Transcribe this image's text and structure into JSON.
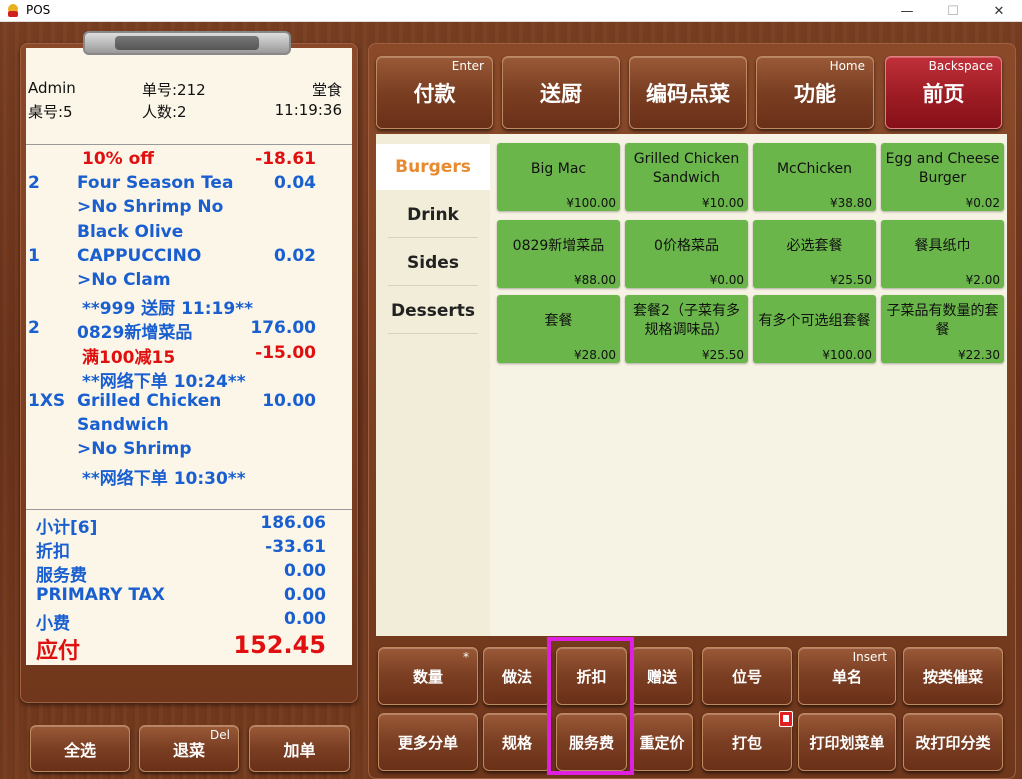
{
  "window": {
    "title": "POS",
    "minimize": "—",
    "maximize": "☐",
    "close": "✕"
  },
  "order": {
    "operator": "Admin",
    "order_no": "单号:212",
    "dine_type": "堂食",
    "table": "桌号:5",
    "guests": "人数:2",
    "time": "11:19:36"
  },
  "lines": [
    {
      "name": "10% off",
      "price": "-18.61",
      "kind": "discount"
    },
    {
      "qty": "2",
      "name": "Four Season Tea",
      "price": "0.04"
    },
    {
      "name": ">No Shrimp No",
      "kind": "mod"
    },
    {
      "name": "Black Olive",
      "kind": "mod"
    },
    {
      "qty": "1",
      "name": "CAPPUCCINO",
      "price": "0.02"
    },
    {
      "name": ">No Clam",
      "kind": "mod"
    },
    {
      "name": "**999 送厨 11:19**",
      "kind": "note"
    },
    {
      "qty": "2",
      "name": "0829新增菜品",
      "price": "176.00"
    },
    {
      "name": "满100减15",
      "price": "-15.00",
      "kind": "discount"
    },
    {
      "name": "**网络下单 10:24**",
      "kind": "note"
    },
    {
      "qty": "1XS",
      "name": "Grilled Chicken",
      "price": "10.00"
    },
    {
      "name": "Sandwich",
      "kind": "mod"
    },
    {
      "name": ">No Shrimp",
      "kind": "mod"
    },
    {
      "name": "**网络下单 10:30**",
      "kind": "note"
    }
  ],
  "totals": [
    {
      "label": "小计[6]",
      "value": "186.06"
    },
    {
      "label": "折扣",
      "value": "-33.61"
    },
    {
      "label": "服务费",
      "value": "0.00"
    },
    {
      "label": "PRIMARY TAX",
      "value": "0.00"
    },
    {
      "label": "小费",
      "value": "0.00"
    }
  ],
  "amount_due": {
    "label": "应付",
    "value": "152.45"
  },
  "left_buttons": [
    {
      "label": "全选"
    },
    {
      "label": "退菜",
      "hint": "Del"
    },
    {
      "label": "加单"
    }
  ],
  "top_buttons": [
    {
      "label": "付款",
      "hint": "Enter"
    },
    {
      "label": "送厨"
    },
    {
      "label": "编码点菜"
    },
    {
      "label": "功能",
      "hint": "Home"
    },
    {
      "label": "前页",
      "hint": "Backspace"
    }
  ],
  "categories": [
    "Burgers",
    "Drink",
    "Sides",
    "Desserts"
  ],
  "active_category": "Burgers",
  "items": [
    {
      "name": "Big Mac",
      "price": "¥100.00"
    },
    {
      "name": "Grilled Chicken Sandwich",
      "price": "¥10.00"
    },
    {
      "name": "McChicken",
      "price": "¥38.80"
    },
    {
      "name": "Egg and Cheese Burger",
      "price": "¥0.02"
    },
    {
      "name": "0829新增菜品",
      "price": "¥88.00"
    },
    {
      "name": "0价格菜品",
      "price": "¥0.00"
    },
    {
      "name": "必选套餐",
      "price": "¥25.50"
    },
    {
      "name": "餐具纸巾",
      "price": "¥2.00"
    },
    {
      "name": "套餐",
      "price": "¥28.00"
    },
    {
      "name": "套餐2（子菜有多规格调味品）",
      "price": "¥25.50"
    },
    {
      "name": "有多个可选组套餐",
      "price": "¥100.00"
    },
    {
      "name": "子菜品有数量的套餐",
      "price": "¥22.30"
    }
  ],
  "bottom_row1": [
    {
      "label": "数量",
      "hint": "*"
    },
    {
      "label": "做法"
    },
    {
      "label": "折扣"
    },
    {
      "label": "赠送"
    },
    {
      "label": "位号"
    },
    {
      "label": "单名",
      "hint": "Insert"
    },
    {
      "label": "按类催菜"
    }
  ],
  "bottom_row2": [
    {
      "label": "更多分单"
    },
    {
      "label": "规格"
    },
    {
      "label": "服务费"
    },
    {
      "label": "重定价"
    },
    {
      "label": "打包"
    },
    {
      "label": "打印划菜单"
    },
    {
      "label": "改打印分类"
    }
  ],
  "colors": {
    "wood": "#7a3f22",
    "paper": "#fbf6e8",
    "item_green": "#6ab64a",
    "text_blue": "#1a5fd0",
    "text_red": "#e01010",
    "highlight": "#e020e0",
    "active_category": "#e88a30"
  }
}
